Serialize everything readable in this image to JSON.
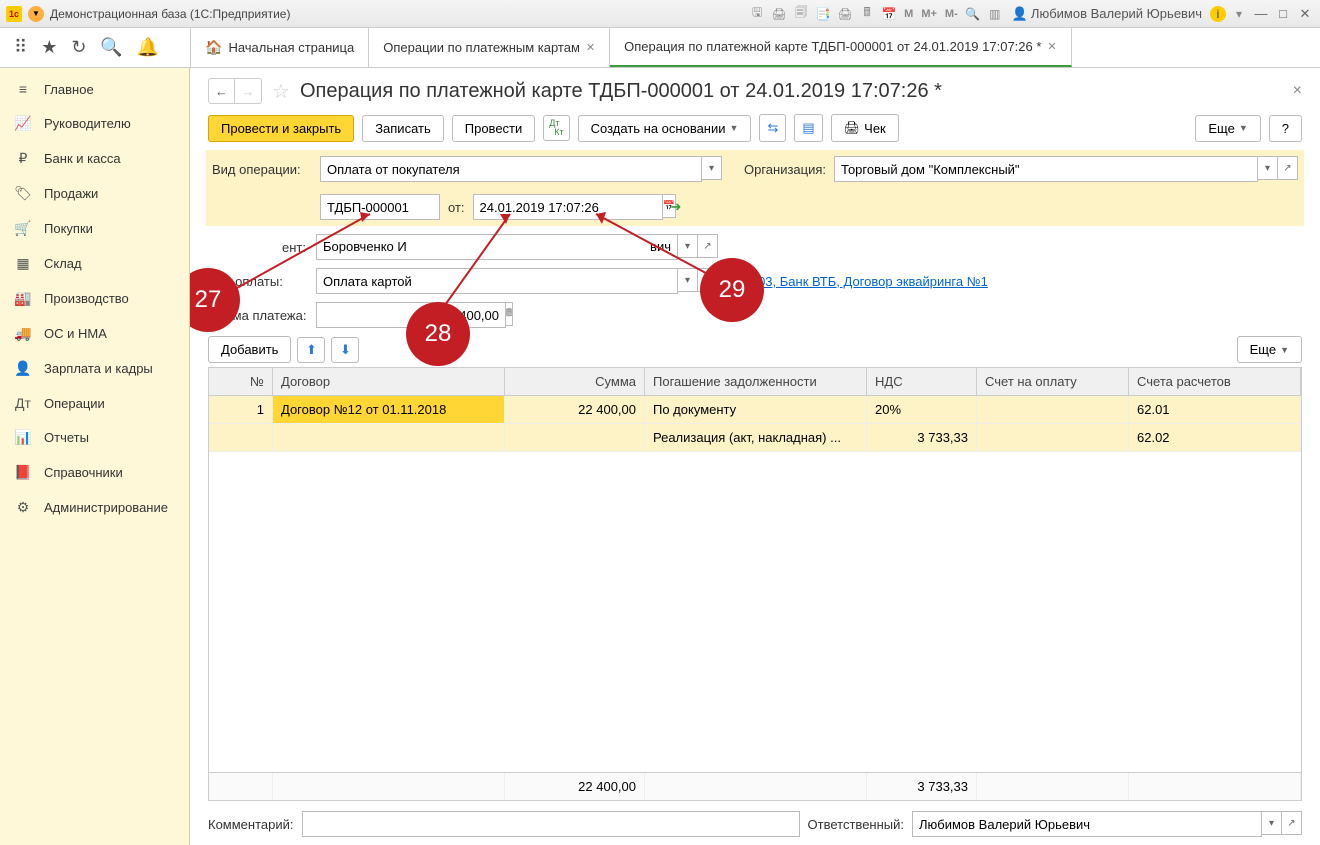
{
  "titlebar": {
    "title": "Демонстрационная база  (1С:Предприятие)",
    "user": "Любимов Валерий Юрьевич",
    "m": "M",
    "mplus": "M+",
    "mminus": "M-"
  },
  "tabs": {
    "home": "Начальная страница",
    "t1": "Операции по платежным картам",
    "t2": "Операция по платежной карте ТДБП-000001 от 24.01.2019 17:07:26 *"
  },
  "sidebar": {
    "items": [
      {
        "icon": "≡",
        "label": "Главное"
      },
      {
        "icon": "📈",
        "label": "Руководителю"
      },
      {
        "icon": "₽",
        "label": "Банк и касса"
      },
      {
        "icon": "🏷",
        "label": "Продажи"
      },
      {
        "icon": "🛒",
        "label": "Покупки"
      },
      {
        "icon": "▦",
        "label": "Склад"
      },
      {
        "icon": "🏭",
        "label": "Производство"
      },
      {
        "icon": "🚚",
        "label": "ОС и НМА"
      },
      {
        "icon": "👤",
        "label": "Зарплата и кадры"
      },
      {
        "icon": "Дт",
        "label": "Операции"
      },
      {
        "icon": "📊",
        "label": "Отчеты"
      },
      {
        "icon": "📕",
        "label": "Справочники"
      },
      {
        "icon": "⚙",
        "label": "Администрирование"
      }
    ]
  },
  "page": {
    "title": "Операция по платежной карте ТДБП-000001 от 24.01.2019 17:07:26 *",
    "btn_post_close": "Провести и закрыть",
    "btn_save": "Записать",
    "btn_post": "Провести",
    "btn_create_based": "Создать на основании",
    "btn_check": "Чек",
    "btn_more": "Еще",
    "btn_help": "?",
    "lbl_vidop": "Вид операции:",
    "val_vidop": "Оплата от покупателя",
    "lbl_org": "Организация:",
    "val_org": "Торговый дом \"Комплексный\"",
    "lbl_numsym": "",
    "val_num": "ТДБП-000001",
    "lbl_ot": "от:",
    "val_date": "24.01.2019 17:07:26",
    "lbl_agent_suffix": "ент:",
    "val_agent": "Боровченко И",
    "val_agent_suffix": "вич",
    "lbl_vidopl": "Вид оплаты:",
    "val_vidopl": "Оплата картой",
    "link_acq": "57.03, Банк ВТБ, Договор эквайринга №1",
    "lbl_sum": "Сумма платежа:",
    "val_sum": "22 400,00",
    "btn_add": "Добавить",
    "lbl_comment": "Комментарий:",
    "lbl_resp": "Ответственный:",
    "val_resp": "Любимов Валерий Юрьевич"
  },
  "table": {
    "headers": {
      "n": "№",
      "dog": "Договор",
      "sum": "Сумма",
      "pog": "Погашение задолженности",
      "nds": "НДС",
      "schet": "Счет на оплату",
      "acc": "Счета расчетов"
    },
    "rows": [
      {
        "n": "1",
        "dog": "Договор №12 от 01.11.2018",
        "sum": "22 400,00",
        "pog": "По документу",
        "nds": "20%",
        "schet": "",
        "acc": "62.01"
      },
      {
        "n": "",
        "dog": "",
        "sum": "",
        "pog": "Реализация (акт, накладная) ...",
        "nds": "3 733,33",
        "schet": "",
        "acc": "62.02"
      }
    ],
    "footer": {
      "sum": "22 400,00",
      "nds": "3 733,33"
    }
  },
  "callouts": {
    "c27": "27",
    "c28": "28",
    "c29": "29"
  }
}
